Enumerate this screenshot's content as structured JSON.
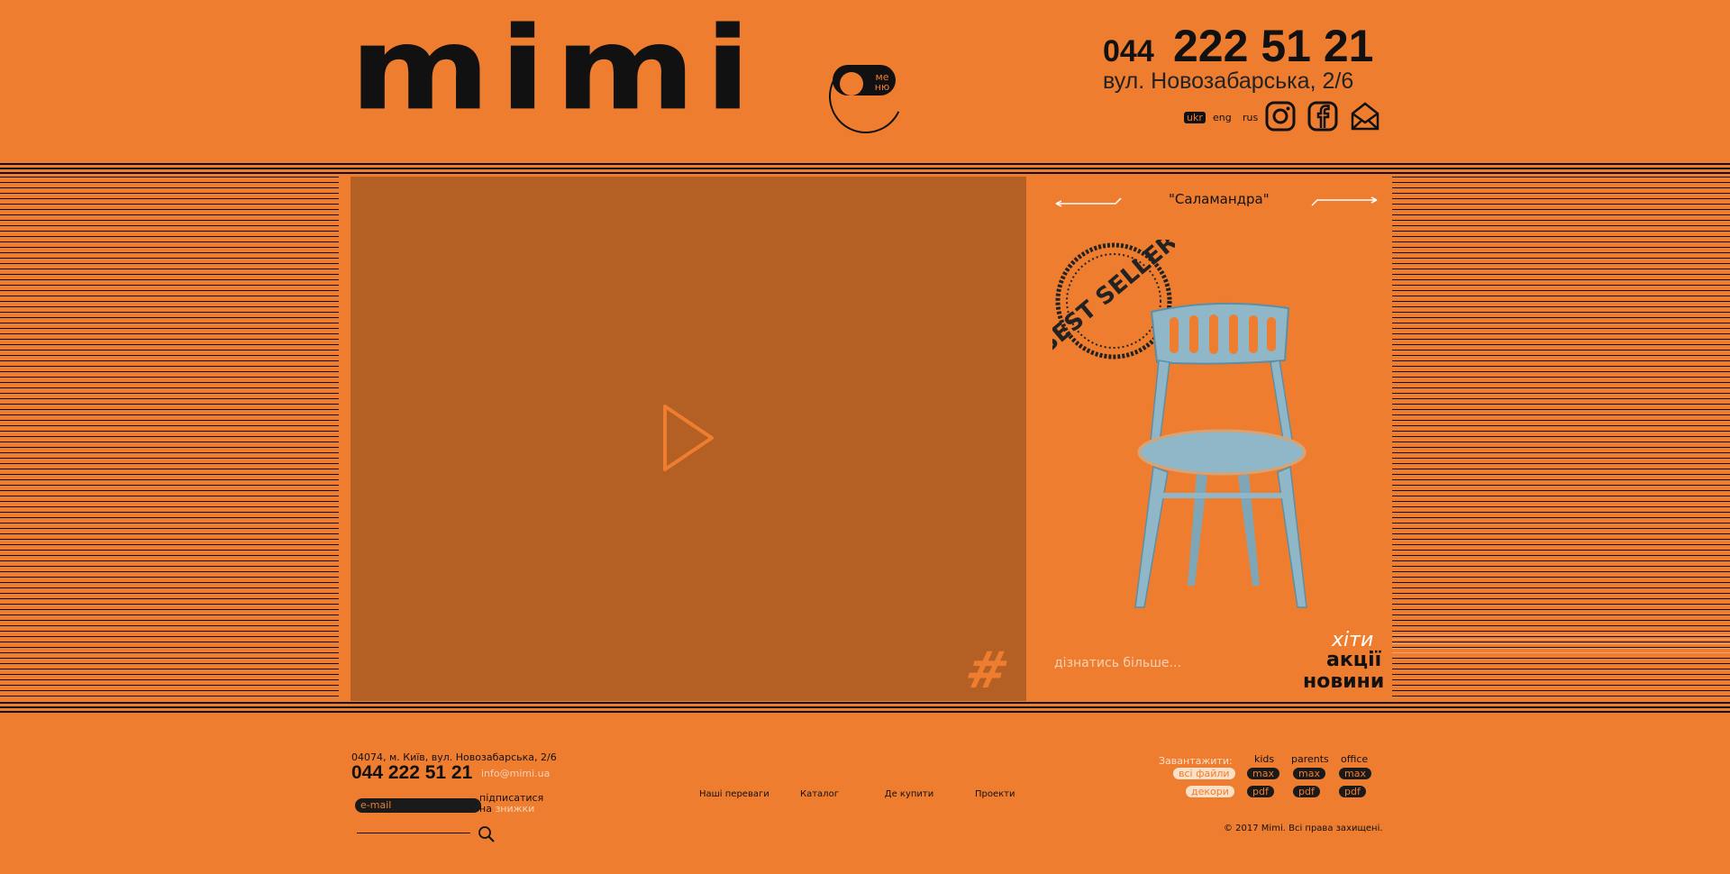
{
  "header": {
    "logo": "mimi",
    "menu_label": "ме ню",
    "phone_prefix": "044",
    "phone_main": "222 51 21",
    "address": "вул. Новозабарська, 2/6",
    "languages": [
      "ukr",
      "eng",
      "rus"
    ],
    "social_icons": [
      "instagram-icon",
      "facebook-icon",
      "mail-icon"
    ]
  },
  "video": {
    "play_icon": "play-icon",
    "hash_glyph": "#"
  },
  "product": {
    "name": "\"Саламандра\"",
    "badge": "BEST SELLER",
    "learn_more": "дізнатись більше...",
    "nav": {
      "hits": "хіти",
      "promo": "акції",
      "news": "новини"
    }
  },
  "footer": {
    "address": "04074, м. Київ, вул. Новозабарська, 2/6",
    "phone": "044 222 51 21",
    "email": "info@mimi.ua",
    "email_placeholder": "e-mail",
    "subscribe_line1": "підписатися",
    "subscribe_line2_prefix": "на",
    "subscribe_line2_accent": "знижки",
    "nav": [
      "Наші переваги",
      "Каталог",
      "Де купити",
      "Проекти"
    ],
    "download": {
      "label": "Завантажити:",
      "all_files": "всі файли",
      "decors": "декори",
      "columns": [
        "kids",
        "parents",
        "office"
      ],
      "row1": [
        "max",
        "max",
        "max"
      ],
      "row2": [
        "pdf",
        "pdf",
        "pdf"
      ]
    },
    "copyright": "© 2017 Mimi. Всі права захищені."
  }
}
